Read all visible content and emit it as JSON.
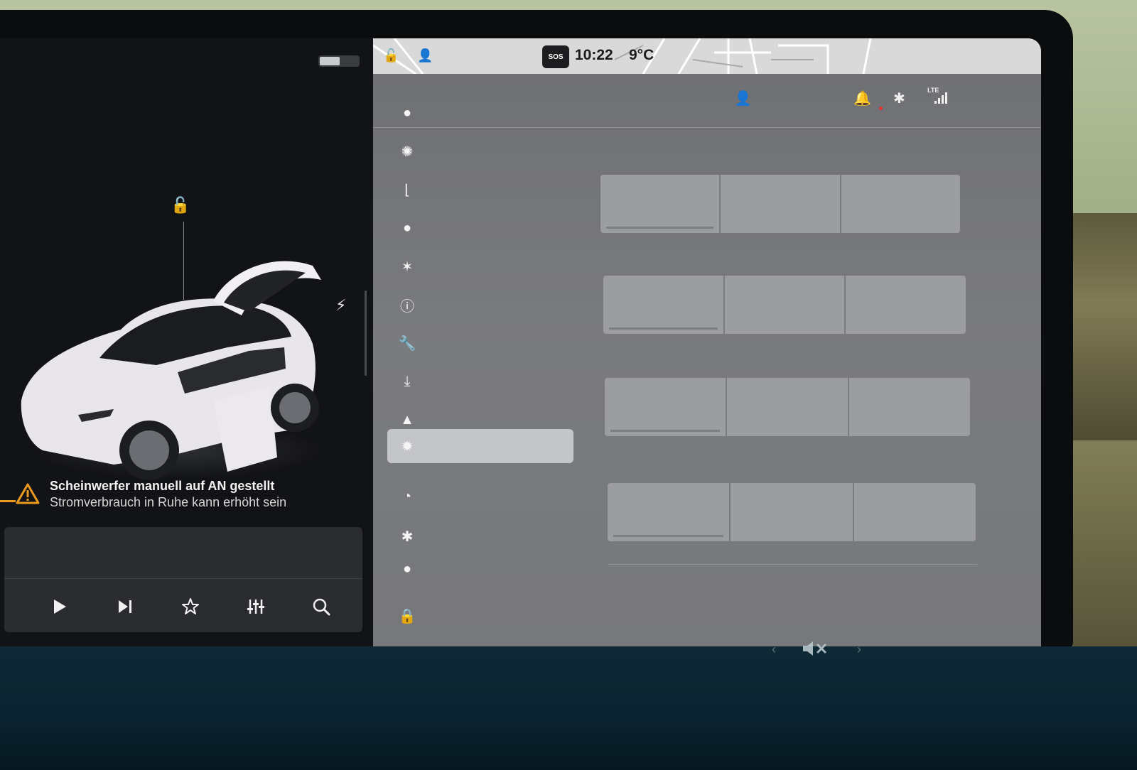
{
  "status_bar": {
    "time": "10:22",
    "temperature": "9°C",
    "sos_label": "SOS",
    "lte_label": "LTE"
  },
  "alert": {
    "title": "Scheinwerfer manuell auf AN gestellt",
    "subtitle": "Stromverbrauch in Ruhe kann erhöht sein",
    "accent_color": "#e99a1f"
  },
  "media_controls": {
    "icons": [
      "play-icon",
      "next-track-icon",
      "favorite-star-icon",
      "equalizer-icon",
      "search-icon"
    ]
  },
  "header_icons": [
    "user-profile-icon",
    "notification-bell-icon",
    "bluetooth-icon",
    "cellular-signal-icon"
  ],
  "nav": {
    "selected_index": 7,
    "items": [
      {
        "icon": "car-icon"
      },
      {
        "icon": "light-icon"
      },
      {
        "icon": "seat-icon"
      },
      {
        "icon": "steering-icon"
      },
      {
        "icon": "autopilot-icon"
      },
      {
        "icon": "safety-icon"
      },
      {
        "icon": "service-icon"
      },
      {
        "icon": "software-icon"
      },
      {
        "icon": "navigation-icon"
      },
      {
        "icon": "display-icon"
      },
      {
        "icon": "wifi-icon"
      },
      {
        "icon": "bluetooth-icon"
      },
      {
        "icon": "upgrades-icon"
      },
      {
        "icon": "lock-icon"
      }
    ]
  },
  "settings_rows": [
    {
      "options": 3
    },
    {
      "options": 3
    },
    {
      "options": 3
    },
    {
      "options": 3
    }
  ]
}
